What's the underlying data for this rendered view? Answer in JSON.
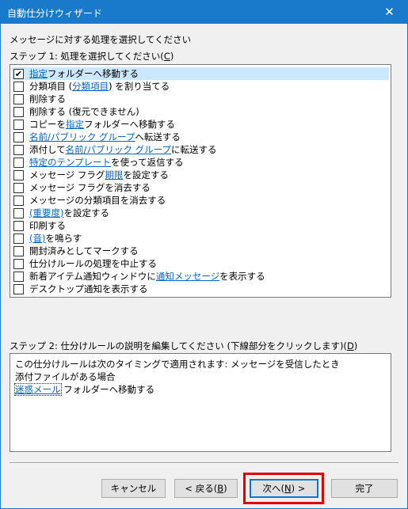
{
  "window": {
    "title": "自動仕分けウィザード",
    "close_glyph": "✕"
  },
  "heading": "メッセージに対する処理を選択してください",
  "step1": {
    "label_prefix": "ステップ 1: 処理を選択してください(",
    "accel": "C",
    "label_suffix": ")"
  },
  "actions": [
    {
      "checked": true,
      "parts": [
        {
          "t": "指定",
          "link": true
        },
        {
          "t": " フォルダーへ移動する"
        }
      ]
    },
    {
      "checked": false,
      "parts": [
        {
          "t": "分類項目 ("
        },
        {
          "t": "分類項目",
          "link": true
        },
        {
          "t": ") を割り当てる"
        }
      ]
    },
    {
      "checked": false,
      "parts": [
        {
          "t": "削除する"
        }
      ]
    },
    {
      "checked": false,
      "parts": [
        {
          "t": "削除する (復元できません)"
        }
      ]
    },
    {
      "checked": false,
      "parts": [
        {
          "t": "コピーを "
        },
        {
          "t": "指定",
          "link": true
        },
        {
          "t": " フォルダーへ移動する"
        }
      ]
    },
    {
      "checked": false,
      "parts": [
        {
          "t": "名前/パブリック グループ",
          "link": true
        },
        {
          "t": " へ転送する"
        }
      ]
    },
    {
      "checked": false,
      "parts": [
        {
          "t": "添付して "
        },
        {
          "t": "名前/パブリック グループ",
          "link": true
        },
        {
          "t": " に転送する"
        }
      ]
    },
    {
      "checked": false,
      "parts": [
        {
          "t": "特定のテンプレート",
          "link": true
        },
        {
          "t": " を使って返信する"
        }
      ]
    },
    {
      "checked": false,
      "parts": [
        {
          "t": "メッセージ フラグ "
        },
        {
          "t": "期限",
          "link": true
        },
        {
          "t": " を設定する"
        }
      ]
    },
    {
      "checked": false,
      "parts": [
        {
          "t": "メッセージ フラグを消去する"
        }
      ]
    },
    {
      "checked": false,
      "parts": [
        {
          "t": "メッセージの分類項目を消去する"
        }
      ]
    },
    {
      "checked": false,
      "parts": [
        {
          "t": "(重要度)",
          "link": true
        },
        {
          "t": " を設定する"
        }
      ]
    },
    {
      "checked": false,
      "parts": [
        {
          "t": "印刷する"
        }
      ]
    },
    {
      "checked": false,
      "parts": [
        {
          "t": "(音)",
          "link": true
        },
        {
          "t": " を鳴らす"
        }
      ]
    },
    {
      "checked": false,
      "parts": [
        {
          "t": "開封済みとしてマークする"
        }
      ]
    },
    {
      "checked": false,
      "parts": [
        {
          "t": "仕分けルールの処理を中止する"
        }
      ]
    },
    {
      "checked": false,
      "parts": [
        {
          "t": "新着アイテム通知ウィンドウに "
        },
        {
          "t": "通知メッセージ",
          "link": true
        },
        {
          "t": " を表示する"
        }
      ]
    },
    {
      "checked": false,
      "parts": [
        {
          "t": "デスクトップ通知を表示する"
        }
      ]
    }
  ],
  "step2": {
    "label_prefix": "ステップ 2: 仕分けルールの説明を編集してください (下線部分をクリックします)(",
    "accel": "D",
    "label_suffix": ")"
  },
  "description": {
    "line1": "この仕分けルールは次のタイミングで適用されます: メッセージを受信したとき",
    "line2": "添付ファイルがある場合",
    "line3_link": "迷惑メール",
    "line3_rest": " フォルダーへ移動する"
  },
  "buttons": {
    "cancel": "キャンセル",
    "back_prefix": "< 戻る(",
    "back_accel": "B",
    "back_suffix": ")",
    "next_prefix": "次へ(",
    "next_accel": "N",
    "next_suffix": ") >",
    "finish": "完了"
  },
  "check_glyph": "✔"
}
